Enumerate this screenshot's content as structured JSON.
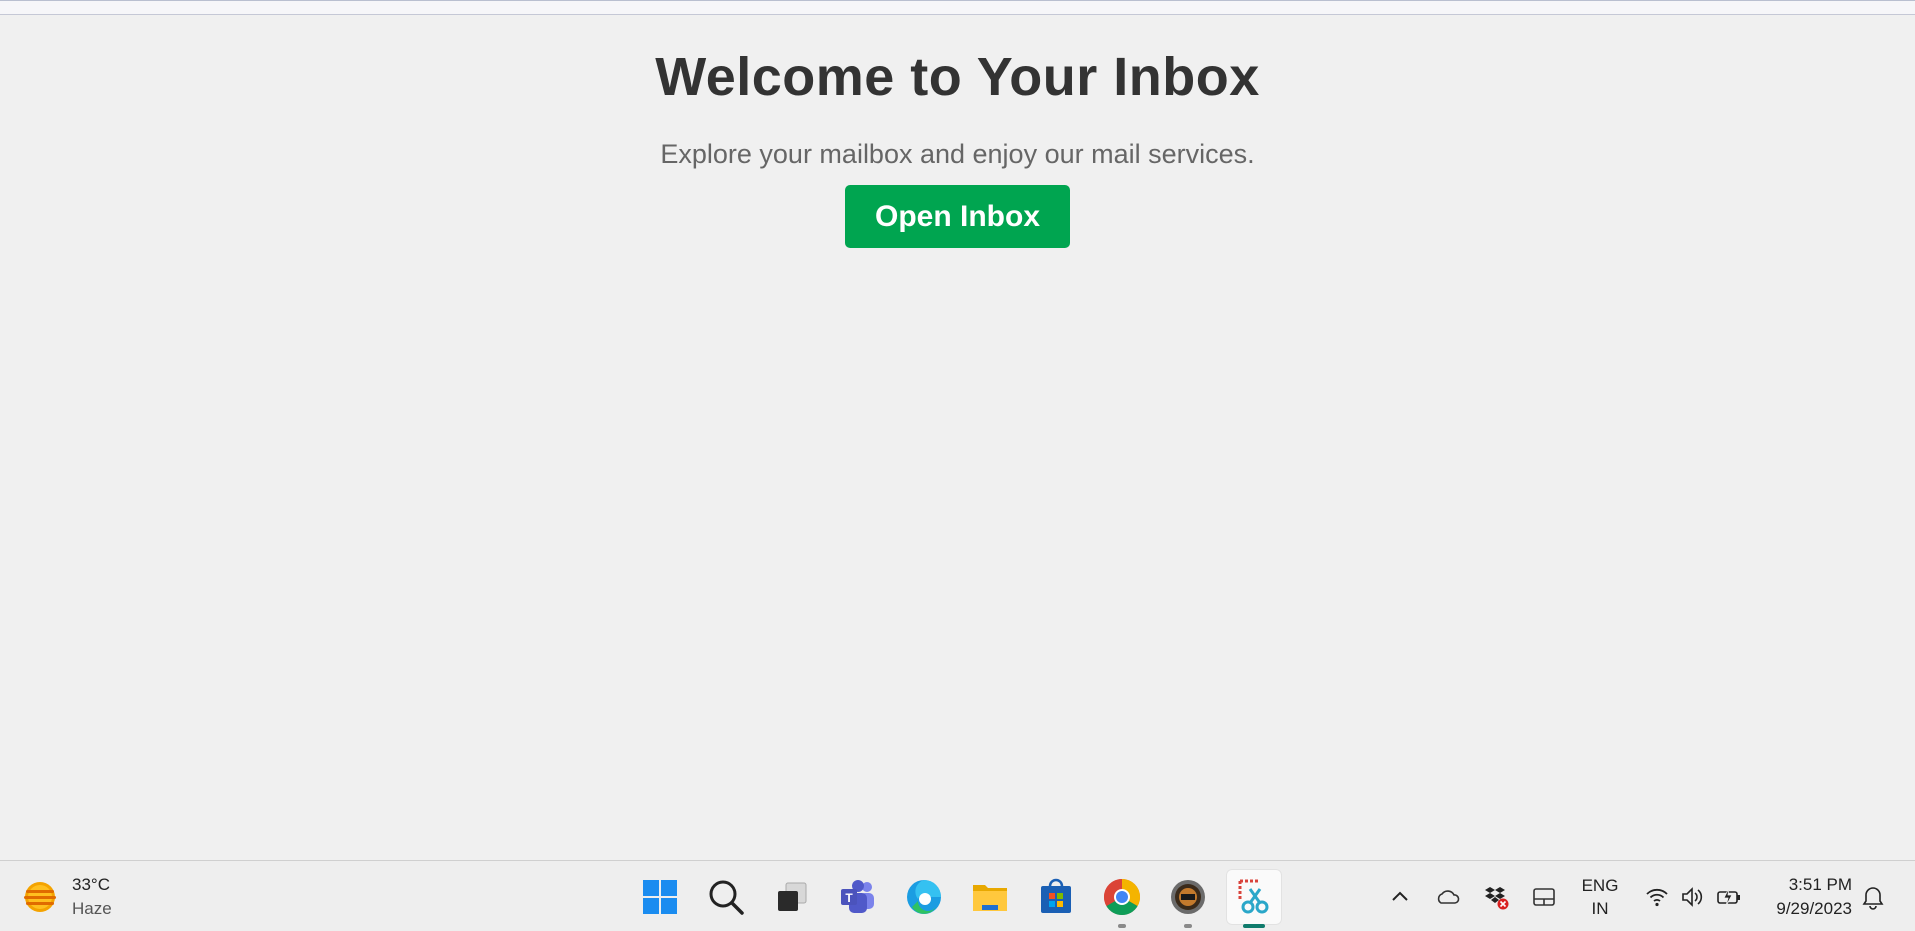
{
  "main": {
    "heading": "Welcome to Your Inbox",
    "subtitle": "Explore your mailbox and enjoy our mail services.",
    "open_button_label": "Open Inbox"
  },
  "taskbar": {
    "weather": {
      "temperature": "33°C",
      "condition": "Haze",
      "icon": "haze-sun-icon"
    },
    "apps": [
      {
        "name": "start-icon",
        "running": false
      },
      {
        "name": "search-icon",
        "running": false
      },
      {
        "name": "task-view-icon",
        "running": false
      },
      {
        "name": "teams-icon",
        "running": false
      },
      {
        "name": "edge-icon",
        "running": false
      },
      {
        "name": "file-explorer-icon",
        "running": false
      },
      {
        "name": "store-icon",
        "running": false
      },
      {
        "name": "chrome-icon",
        "running": true
      },
      {
        "name": "gear-app-icon",
        "running": true
      },
      {
        "name": "snipping-tool-icon",
        "running": true,
        "active": true
      }
    ],
    "tray": {
      "icons": [
        "chevron-up-icon",
        "onedrive-cloud-icon",
        "dropbox-error-icon",
        "touchpad-icon"
      ],
      "language": {
        "line1": "ENG",
        "line2": "IN"
      },
      "status_icons": [
        "wifi-icon",
        "volume-icon",
        "battery-charging-icon"
      ],
      "time": "3:51 PM",
      "date": "9/29/2023",
      "notification_icon": "bell-icon"
    }
  },
  "colors": {
    "background": "#f0f0f0",
    "heading": "#333333",
    "subtitle": "#666666",
    "button": "#00a550",
    "button_text": "#ffffff",
    "taskbar": "#eeeeee"
  }
}
